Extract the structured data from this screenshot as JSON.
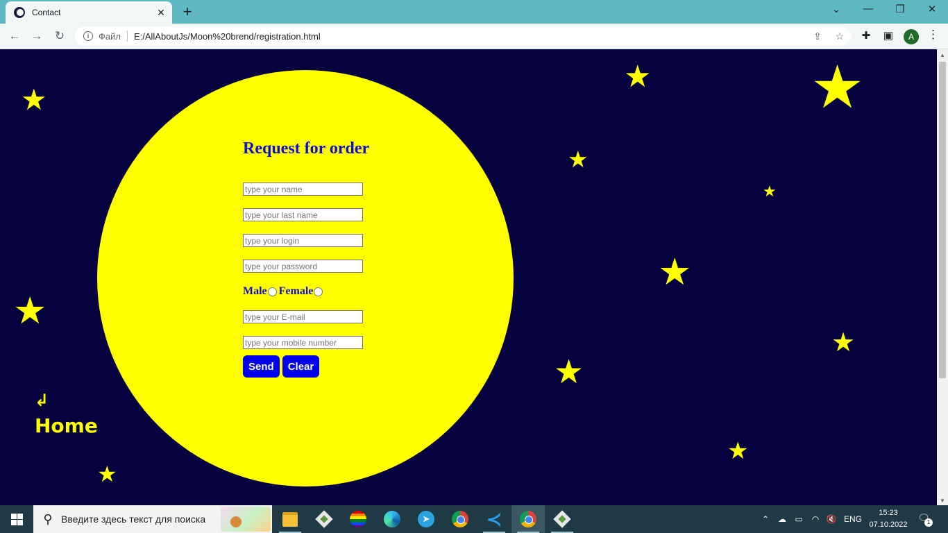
{
  "browser": {
    "tab_title": "Contact",
    "tab_close": "✕",
    "new_tab": "+",
    "window_controls": [
      "⌄",
      "—",
      "❐",
      "✕"
    ],
    "address": {
      "scheme_label": "Файл",
      "url": "E:/AllAboutJs/Moon%20brend/registration.html"
    },
    "icons": [
      "back-arrow-icon",
      "forward-arrow-icon",
      "reload-icon",
      "share-icon",
      "star-bookmark-icon",
      "extensions-puzzle-icon",
      "side-panel-icon",
      "menu-kebab-icon"
    ],
    "profile_initial": "A"
  },
  "page": {
    "form": {
      "title": "Request for order",
      "fields": {
        "name": "type your name",
        "last_name": "type your last name",
        "login": "type your login",
        "password": "type your password",
        "email": "type your E-mail",
        "mobile": "type your mobile number"
      },
      "gender": {
        "male": "Male",
        "female": "Female"
      },
      "send_label": "Send",
      "clear_label": "Clear"
    },
    "home": {
      "icon": "↲",
      "label": "Home"
    },
    "colors": {
      "background": "#05023f",
      "moon": "#ffff00",
      "accent": "#0000ee",
      "title": "#1010c8"
    }
  },
  "taskbar": {
    "search_placeholder": "Введите здесь текст для поиска",
    "apps": [
      "file-explorer",
      "git-gui",
      "pride-app",
      "edge",
      "telegram",
      "chrome",
      "vscode",
      "chrome-profile-active",
      "git-gui-2"
    ],
    "language": "ENG",
    "time": "15:23",
    "date": "07.10.2022",
    "notification_count": "1"
  }
}
